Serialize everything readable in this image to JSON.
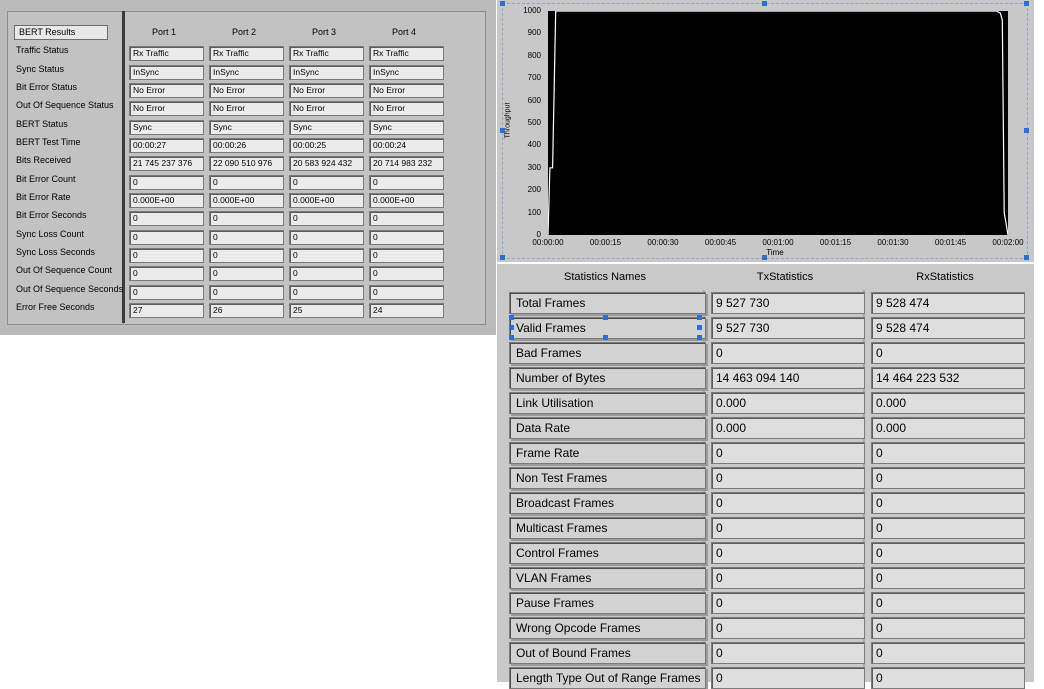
{
  "bert": {
    "title": "BERT Results",
    "ports": [
      "Port 1",
      "Port 2",
      "Port 3",
      "Port 4"
    ],
    "rows": [
      {
        "label": "Traffic Status",
        "values": [
          "Rx Traffic",
          "Rx Traffic",
          "Rx Traffic",
          "Rx Traffic"
        ]
      },
      {
        "label": "Sync Status",
        "values": [
          "InSync",
          "InSync",
          "InSync",
          "InSync"
        ]
      },
      {
        "label": "Bit Error Status",
        "values": [
          "No Error",
          "No Error",
          "No Error",
          "No Error"
        ]
      },
      {
        "label": "Out Of Sequence Status",
        "values": [
          "No Error",
          "No Error",
          "No Error",
          "No Error"
        ]
      },
      {
        "label": "BERT Status",
        "values": [
          "Sync",
          "Sync",
          "Sync",
          "Sync"
        ]
      },
      {
        "label": "BERT Test Time",
        "values": [
          "00:00:27",
          "00:00:26",
          "00:00:25",
          "00:00:24"
        ]
      },
      {
        "label": "Bits Received",
        "values": [
          "21 745 237 376",
          "22 090 510 976",
          "20 583 924 432",
          "20 714 983 232"
        ]
      },
      {
        "label": "Bit Error Count",
        "values": [
          "0",
          "0",
          "0",
          "0"
        ]
      },
      {
        "label": "Bit Error Rate",
        "values": [
          "0.000E+00",
          "0.000E+00",
          "0.000E+00",
          "0.000E+00"
        ]
      },
      {
        "label": "Bit Error Seconds",
        "values": [
          "0",
          "0",
          "0",
          "0"
        ]
      },
      {
        "label": "Sync Loss Count",
        "values": [
          "0",
          "0",
          "0",
          "0"
        ]
      },
      {
        "label": "Sync Loss Seconds",
        "values": [
          "0",
          "0",
          "0",
          "0"
        ]
      },
      {
        "label": "Out Of Sequence Count",
        "values": [
          "0",
          "0",
          "0",
          "0"
        ]
      },
      {
        "label": "Out Of Sequence Seconds",
        "values": [
          "0",
          "0",
          "0",
          "0"
        ]
      },
      {
        "label": "Error Free Seconds",
        "values": [
          "27",
          "26",
          "25",
          "24"
        ]
      }
    ]
  },
  "graph": {
    "ylabel": "Throughput",
    "xlabel": "Time",
    "yticks": [
      "1000",
      "900",
      "800",
      "700",
      "600",
      "500",
      "400",
      "300",
      "200",
      "100",
      "0"
    ],
    "xticks": [
      "00:00:00",
      "00:00:15",
      "00:00:30",
      "00:00:45",
      "00:01:00",
      "00:01:15",
      "00:01:30",
      "00:01:45",
      "00:02:00"
    ],
    "ylim": [
      0,
      1000
    ],
    "xlim_seconds": [
      0,
      120
    ],
    "line_color": "#ffffff",
    "background": "#000000",
    "series_seconds": [
      0,
      0.5,
      1.2,
      2.0,
      117.0,
      118.0,
      118.5,
      119.0,
      120
    ],
    "series_values": [
      0,
      300,
      300,
      1000,
      1000,
      990,
      960,
      100,
      0
    ]
  },
  "stats": {
    "headers": [
      "Statistics Names",
      "TxStatistics",
      "RxStatistics"
    ],
    "rows": [
      {
        "name": "Total Frames",
        "tx": "9 527 730",
        "rx": "9 528 474"
      },
      {
        "name": "Valid Frames",
        "tx": "9 527 730",
        "rx": "9 528 474"
      },
      {
        "name": "Bad Frames",
        "tx": "0",
        "rx": "0"
      },
      {
        "name": "Number of Bytes",
        "tx": "14 463 094 140",
        "rx": "14 464 223 532"
      },
      {
        "name": "Link Utilisation",
        "tx": "0.000",
        "rx": "0.000"
      },
      {
        "name": "Data Rate",
        "tx": "0.000",
        "rx": "0.000"
      },
      {
        "name": "Frame Rate",
        "tx": "0",
        "rx": "0"
      },
      {
        "name": "Non Test Frames",
        "tx": "0",
        "rx": "0"
      },
      {
        "name": "Broadcast Frames",
        "tx": "0",
        "rx": "0"
      },
      {
        "name": "Multicast Frames",
        "tx": "0",
        "rx": "0"
      },
      {
        "name": "Control Frames",
        "tx": "0",
        "rx": "0"
      },
      {
        "name": "VLAN Frames",
        "tx": "0",
        "rx": "0"
      },
      {
        "name": "Pause Frames",
        "tx": "0",
        "rx": "0"
      },
      {
        "name": "Wrong Opcode Frames",
        "tx": "0",
        "rx": "0"
      },
      {
        "name": "Out of Bound Frames",
        "tx": "0",
        "rx": "0"
      },
      {
        "name": "Length Type Out of Range Frames",
        "tx": "0",
        "rx": "0"
      }
    ]
  },
  "colors": {
    "panel": "#bababa",
    "field": "#ebebeb",
    "selection_handle": "#2a6fd1"
  }
}
